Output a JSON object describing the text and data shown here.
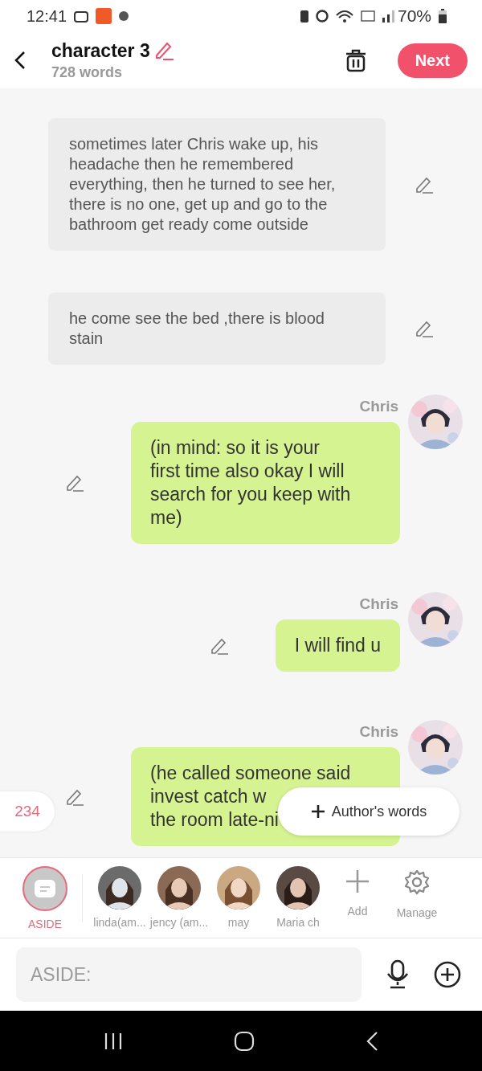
{
  "status_bar": {
    "time": "12:41",
    "battery": "70%"
  },
  "header": {
    "title": "character 3",
    "subtitle": "728 words",
    "next_button": "Next"
  },
  "messages": [
    {
      "kind": "narration",
      "text": "sometimes later Chris wake up, his headache then he remembered everything, then he turned to see her, there is no one, get up and go to the bathroom get ready come outside"
    },
    {
      "kind": "narration",
      "text": "he come see the bed ,there is blood stain"
    },
    {
      "kind": "dialogue",
      "speaker": "Chris",
      "lines": [
        "(in mind: so it is your",
        "first time also okay I will",
        "search for you keep with",
        "me)"
      ]
    },
    {
      "kind": "dialogue",
      "speaker": "Chris",
      "lines": [
        "I will find u"
      ]
    },
    {
      "kind": "dialogue",
      "speaker": "Chris",
      "lines": [
        "(he called someone said",
        "invest catch w",
        "the room late-ni"
      ]
    }
  ],
  "count_badge": "234",
  "authors_words_button": "Author's words",
  "characters": [
    {
      "kind": "aside",
      "name": "ASIDE",
      "selected": true
    },
    {
      "kind": "character",
      "name": "linda(am...",
      "selected": false
    },
    {
      "kind": "character",
      "name": "jency (am...",
      "selected": false
    },
    {
      "kind": "character",
      "name": "may",
      "selected": false
    },
    {
      "kind": "character",
      "name": "Maria ch",
      "selected": false
    },
    {
      "kind": "add",
      "name": "Add",
      "selected": false
    },
    {
      "kind": "manage",
      "name": "Manage",
      "selected": false
    }
  ],
  "input": {
    "placeholder": "ASIDE:"
  }
}
